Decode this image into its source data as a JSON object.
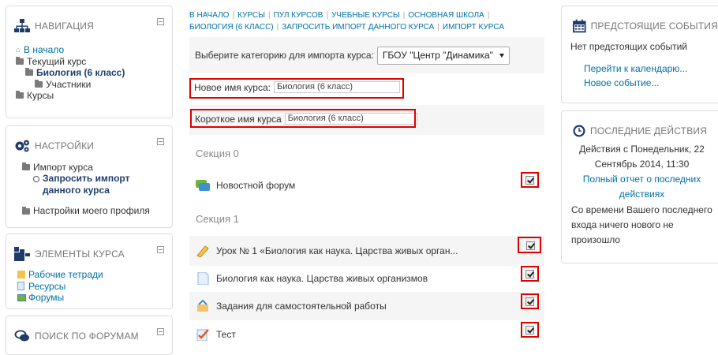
{
  "navigation": {
    "title": "Навигация",
    "items": [
      {
        "label": "В начало"
      },
      {
        "label": "Текущий курс"
      },
      {
        "label": "Биология (6 класс)"
      },
      {
        "label": "Участники"
      },
      {
        "label": "Курсы"
      }
    ]
  },
  "settings": {
    "title": "Настройки",
    "items": [
      {
        "label": "Импорт курса"
      },
      {
        "label": "Запросить импорт"
      },
      {
        "label": "данного курса"
      },
      {
        "label": "Настройки моего профиля"
      }
    ]
  },
  "course_elements": {
    "title": "Элементы курса",
    "items": [
      {
        "label": "Рабочие тетради"
      },
      {
        "label": "Ресурсы"
      },
      {
        "label": "Форумы"
      }
    ]
  },
  "forum_search": {
    "title": "Поиск по форумам"
  },
  "breadcrumbs": {
    "line1": [
      "В начало",
      "Курсы",
      "Пул курсов",
      "Учебные курсы",
      "Основная школа"
    ],
    "line2": [
      "Биология (6 класс)",
      "Запросить импорт данного курса",
      "Импорт курса"
    ]
  },
  "import_form": {
    "category_label": "Выберите категорию для импорта курса:",
    "category_value": "ГБОУ \"Центр \"Динамика\"",
    "new_name_label": "Новое имя курса:",
    "new_name_value": "Биология (6 класс)",
    "short_name_label": "Короткое имя курса",
    "short_name_value": "Биология (6 класс)"
  },
  "sections": [
    {
      "title": "Секция 0",
      "activities": [
        {
          "name": "Новостной форум",
          "checked": true
        }
      ]
    },
    {
      "title": "Секция 1",
      "activities": [
        {
          "name": "Урок № 1 «Биология как наука. Царства живых орган...",
          "checked": true
        },
        {
          "name": "Биология как наука. Царства живых организмов",
          "checked": true
        },
        {
          "name": "Задания для самостоятельной работы",
          "checked": true
        },
        {
          "name": "Тест",
          "checked": true
        }
      ]
    }
  ],
  "upcoming_events": {
    "title": "Предстоящие события",
    "empty_text": "Нет предстоящих событий",
    "calendar_link": "Перейти к календарю...",
    "new_event_link": "Новое событие..."
  },
  "recent_activity": {
    "title": "Последние действия",
    "since_line1": "Действия с Понедельник, 22",
    "since_line2": "Сентябрь 2014, 11:30",
    "report_line1": "Полный отчет о последних",
    "report_line2": "действиях",
    "none_line1": "Со времени Вашего последнего",
    "none_line2": "входа ничего нового не",
    "none_line3": "произошло"
  },
  "colors": {
    "accent": "#0070a8",
    "highlight": "#e00000",
    "block_border": "#dddddd"
  }
}
